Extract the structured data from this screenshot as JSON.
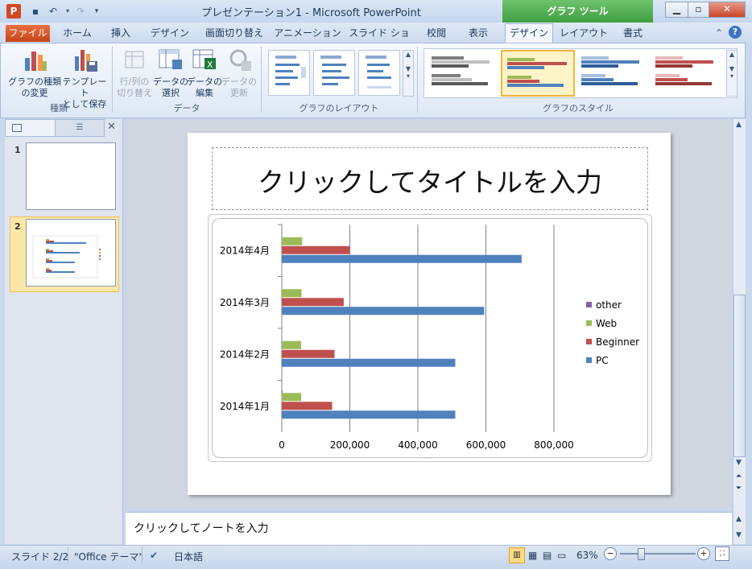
{
  "window": {
    "title": "プレゼンテーション1  -  Microsoft PowerPoint",
    "context_tab_group": "グラフ ツール",
    "app_icon_letter": "P"
  },
  "tabs": [
    "ファイル",
    "ホーム",
    "挿入",
    "デザイン",
    "画面切り替え",
    "アニメーション",
    "スライド ショー",
    "校閲",
    "表示",
    "デザイン",
    "レイアウト",
    "書式"
  ],
  "ribbon": {
    "groups": {
      "type": {
        "label": "種類",
        "buttons": [
          {
            "line1": "グラフの種類",
            "line2": "の変更"
          },
          {
            "line1": "テンプレート",
            "line2": "として保存"
          }
        ]
      },
      "data": {
        "label": "データ",
        "buttons": [
          {
            "line1": "行/列の",
            "line2": "切り替え"
          },
          {
            "line1": "データの",
            "line2": "選択"
          },
          {
            "line1": "データの",
            "line2": "編集"
          },
          {
            "line1": "データの",
            "line2": "更新"
          }
        ]
      },
      "layouts": {
        "label": "グラフのレイアウト"
      },
      "styles": {
        "label": "グラフのスタイル"
      }
    }
  },
  "slides_pane": {
    "slides": [
      {
        "number": "1"
      },
      {
        "number": "2"
      }
    ]
  },
  "slide": {
    "title_placeholder": "クリックしてタイトルを入力"
  },
  "notes_placeholder": "クリックしてノートを入力",
  "statusbar": {
    "slide_indicator": "スライド 2/2",
    "theme": "\"Office テーマ\"",
    "language": "日本語",
    "zoom": "63%"
  },
  "colors": {
    "series_pc": "#4f81bd",
    "series_beginner": "#c0504d",
    "series_web": "#9bbb59",
    "series_other": "#8064a2",
    "file_tab": "#d24726",
    "context_group": "#4aa84a"
  },
  "chart_data": {
    "type": "bar",
    "orientation": "horizontal",
    "categories": [
      "2014年1月",
      "2014年2月",
      "2014年3月",
      "2014年4月"
    ],
    "series": [
      {
        "name": "PC",
        "values": [
          510000,
          510000,
          595000,
          705000
        ]
      },
      {
        "name": "Beginner",
        "values": [
          148000,
          155000,
          182000,
          200000
        ]
      },
      {
        "name": "Web",
        "values": [
          57000,
          57000,
          58000,
          60000
        ]
      },
      {
        "name": "other",
        "values": [
          1000,
          0,
          0,
          0
        ]
      }
    ],
    "xticks": [
      "0",
      "200,000",
      "400,000",
      "600,000",
      "800,000"
    ],
    "xlim": [
      0,
      800000
    ],
    "grid": true,
    "legend_position": "right",
    "legend_order": [
      "other",
      "Web",
      "Beginner",
      "PC"
    ]
  }
}
